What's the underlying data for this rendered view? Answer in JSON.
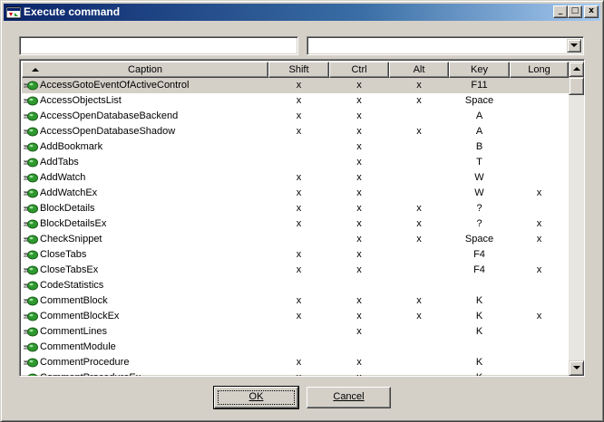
{
  "window": {
    "title": "Execute command"
  },
  "filter": {
    "value": "",
    "combo_value": ""
  },
  "columns": [
    {
      "key": "caption",
      "label": "Caption"
    },
    {
      "key": "shift",
      "label": "Shift"
    },
    {
      "key": "ctrl",
      "label": "Ctrl"
    },
    {
      "key": "alt",
      "label": "Alt"
    },
    {
      "key": "key",
      "label": "Key"
    },
    {
      "key": "long",
      "label": "Long"
    }
  ],
  "rows": [
    {
      "caption": "AccessGotoEventOfActiveControl",
      "shift": "x",
      "ctrl": "x",
      "alt": "x",
      "key": "F11",
      "long": ""
    },
    {
      "caption": "AccessObjectsList",
      "shift": "x",
      "ctrl": "x",
      "alt": "x",
      "key": "Space",
      "long": ""
    },
    {
      "caption": "AccessOpenDatabaseBackend",
      "shift": "x",
      "ctrl": "x",
      "alt": "",
      "key": "A",
      "long": ""
    },
    {
      "caption": "AccessOpenDatabaseShadow",
      "shift": "x",
      "ctrl": "x",
      "alt": "x",
      "key": "A",
      "long": ""
    },
    {
      "caption": "AddBookmark",
      "shift": "",
      "ctrl": "x",
      "alt": "",
      "key": "B",
      "long": ""
    },
    {
      "caption": "AddTabs",
      "shift": "",
      "ctrl": "x",
      "alt": "",
      "key": "T",
      "long": ""
    },
    {
      "caption": "AddWatch",
      "shift": "x",
      "ctrl": "x",
      "alt": "",
      "key": "W",
      "long": ""
    },
    {
      "caption": "AddWatchEx",
      "shift": "x",
      "ctrl": "x",
      "alt": "",
      "key": "W",
      "long": "x"
    },
    {
      "caption": "BlockDetails",
      "shift": "x",
      "ctrl": "x",
      "alt": "x",
      "key": "?",
      "long": ""
    },
    {
      "caption": "BlockDetailsEx",
      "shift": "x",
      "ctrl": "x",
      "alt": "x",
      "key": "?",
      "long": "x"
    },
    {
      "caption": "CheckSnippet",
      "shift": "",
      "ctrl": "x",
      "alt": "x",
      "key": "Space",
      "long": "x"
    },
    {
      "caption": "CloseTabs",
      "shift": "x",
      "ctrl": "x",
      "alt": "",
      "key": "F4",
      "long": ""
    },
    {
      "caption": "CloseTabsEx",
      "shift": "x",
      "ctrl": "x",
      "alt": "",
      "key": "F4",
      "long": "x"
    },
    {
      "caption": "CodeStatistics",
      "shift": "",
      "ctrl": "",
      "alt": "",
      "key": "",
      "long": ""
    },
    {
      "caption": "CommentBlock",
      "shift": "x",
      "ctrl": "x",
      "alt": "x",
      "key": "K",
      "long": ""
    },
    {
      "caption": "CommentBlockEx",
      "shift": "x",
      "ctrl": "x",
      "alt": "x",
      "key": "K",
      "long": "x"
    },
    {
      "caption": "CommentLines",
      "shift": "",
      "ctrl": "x",
      "alt": "",
      "key": "K",
      "long": ""
    },
    {
      "caption": "CommentModule",
      "shift": "",
      "ctrl": "",
      "alt": "",
      "key": "",
      "long": ""
    },
    {
      "caption": "CommentProcedure",
      "shift": "x",
      "ctrl": "x",
      "alt": "",
      "key": "K",
      "long": ""
    },
    {
      "caption": "CommentProcedureEx",
      "shift": "x",
      "ctrl": "x",
      "alt": "",
      "key": "K",
      "long": ""
    }
  ],
  "selected_row": 0,
  "buttons": {
    "ok": "OK",
    "cancel": "Cancel"
  },
  "title_buttons": {
    "minimize": "_",
    "maximize": "□",
    "close": "x"
  },
  "icons": {
    "app": "app-icon",
    "row": "command-icon"
  },
  "colors": {
    "title_start": "#0a246a",
    "title_end": "#a6caf0",
    "face": "#d4d0c8",
    "icon_green": "#2e9a2e"
  }
}
